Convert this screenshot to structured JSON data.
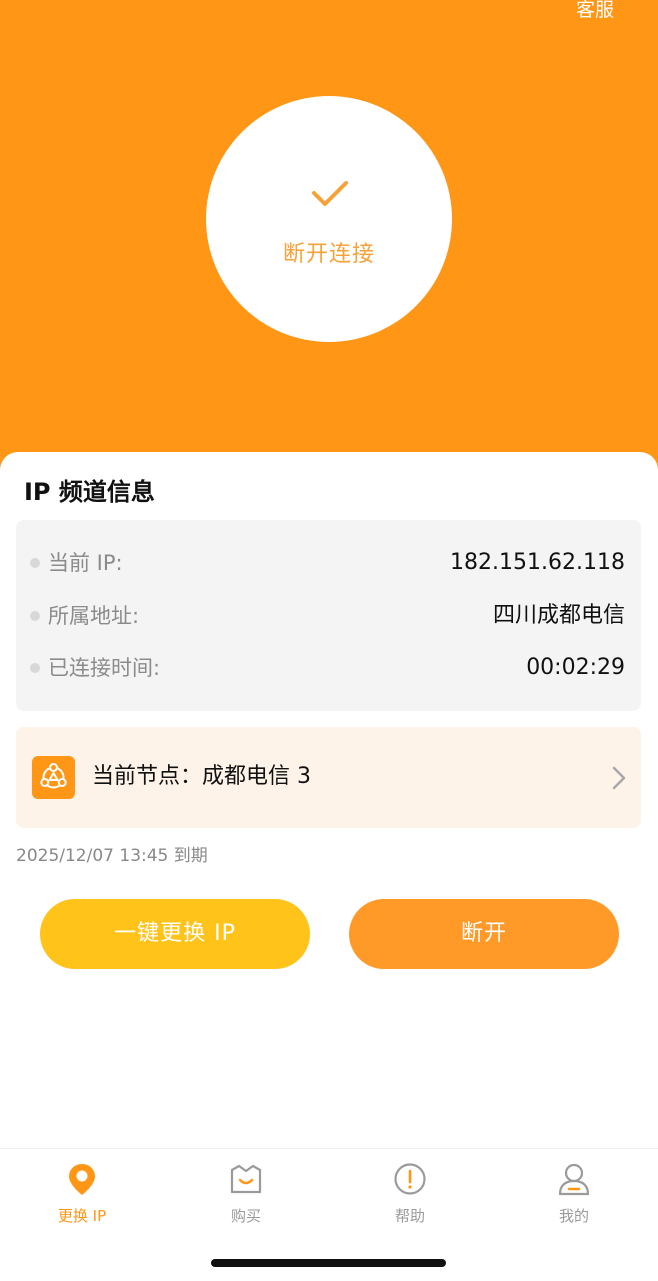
{
  "header": {
    "service_label": "客服"
  },
  "connect_button": {
    "icon": "check-icon",
    "label": "断开连接"
  },
  "ip_info": {
    "title": "IP 频道信息",
    "rows": [
      {
        "label": "当前 IP:",
        "value": "182.151.62.118"
      },
      {
        "label": "所属地址:",
        "value": "四川成都电信"
      },
      {
        "label": "已连接时间:",
        "value": "00:02:29"
      }
    ]
  },
  "node": {
    "icon": "node-icon",
    "label": "当前节点：成都电信 3"
  },
  "expiry": "2025/12/07 13:45 到期",
  "actions": {
    "change_ip_label": "一键更换 IP",
    "disconnect_label": "断开"
  },
  "tabbar": {
    "items": [
      {
        "label": "更换 IP",
        "icon": "location-pin-icon",
        "active": true
      },
      {
        "label": "购买",
        "icon": "shopping-bag-icon",
        "active": false
      },
      {
        "label": "帮助",
        "icon": "help-icon",
        "active": false
      },
      {
        "label": "我的",
        "icon": "user-icon",
        "active": false
      }
    ]
  },
  "colors": {
    "accent": "#FF9616",
    "change_button": "#FFC31A",
    "disconnect_button": "#FF9A28",
    "node_card_bg": "#FDF3E9",
    "info_card_bg": "#F4F4F4"
  }
}
